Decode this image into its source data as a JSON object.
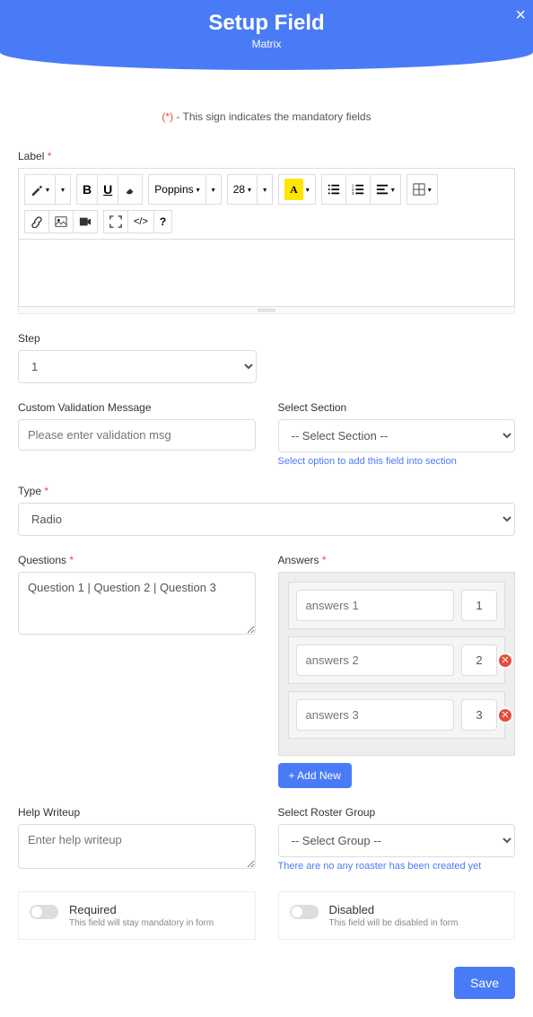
{
  "header": {
    "title": "Setup Field",
    "subtitle": "Matrix"
  },
  "mandatory_note": {
    "star": "(*)",
    "text": " - This sign indicates the mandatory fields"
  },
  "labels": {
    "label": "Label",
    "step": "Step",
    "custom_validation": "Custom Validation Message",
    "select_section": "Select Section",
    "type": "Type",
    "questions": "Questions",
    "answers": "Answers",
    "help": "Help Writeup",
    "roster": "Select Roster Group"
  },
  "toolbar": {
    "font": "Poppins",
    "size": "28"
  },
  "step": {
    "value": "1"
  },
  "validation": {
    "placeholder": "Please enter validation msg"
  },
  "section": {
    "placeholder": "-- Select Section --",
    "hint": "Select option to add this field into section"
  },
  "type": {
    "value": "Radio"
  },
  "questions": {
    "value": "Question 1 | Question 2 | Question 3"
  },
  "answers": {
    "rows": [
      {
        "placeholder": "answers 1",
        "num": "1",
        "deletable": false
      },
      {
        "placeholder": "answers 2",
        "num": "2",
        "deletable": true
      },
      {
        "placeholder": "answers 3",
        "num": "3",
        "deletable": true
      }
    ],
    "add_label": "+ Add New"
  },
  "help": {
    "placeholder": "Enter help writeup"
  },
  "roster": {
    "placeholder": "-- Select Group --",
    "hint": "There are no any roaster has been created yet"
  },
  "toggles": {
    "required": {
      "title": "Required",
      "desc": "This field will stay mandatory in form"
    },
    "disabled": {
      "title": "Disabled",
      "desc": "This field will be disabled in form"
    }
  },
  "save": "Save"
}
